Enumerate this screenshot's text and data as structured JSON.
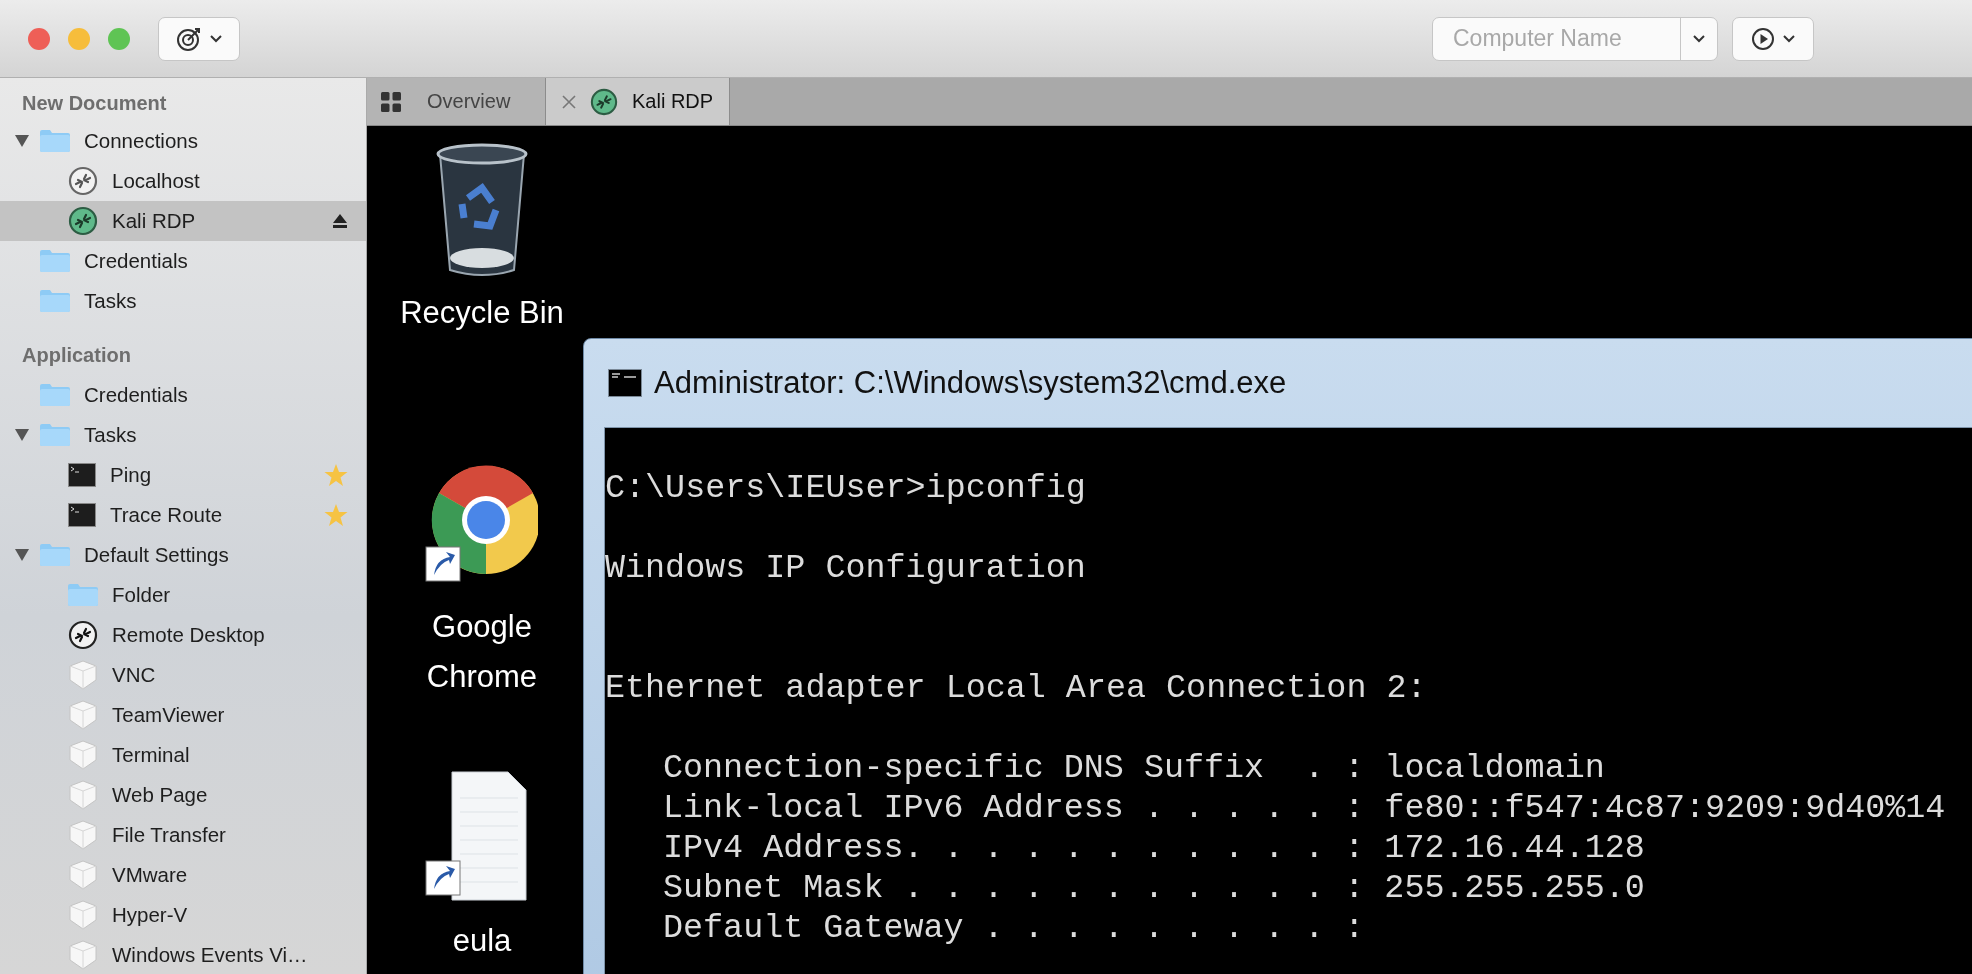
{
  "toolbar": {
    "computer_name": {
      "placeholder": "Computer Name"
    }
  },
  "tabs": [
    {
      "label": "Overview",
      "kind": "overview",
      "selected": false
    },
    {
      "label": "Kali RDP",
      "kind": "rdp",
      "selected": true
    }
  ],
  "sidebar": {
    "sections": [
      {
        "title": "New Document",
        "items": [
          {
            "label": "Connections",
            "kind": "folder",
            "selected": false,
            "expanded": true,
            "children": [
              {
                "label": "Localhost",
                "kind": "rdp",
                "selected": false,
                "connected": false
              },
              {
                "label": "Kali RDP",
                "kind": "rdp",
                "selected": true,
                "connected": true
              }
            ]
          },
          {
            "label": "Credentials",
            "kind": "folder",
            "selected": false
          },
          {
            "label": "Tasks",
            "kind": "folder",
            "selected": false
          }
        ]
      },
      {
        "title": "Application",
        "items": [
          {
            "label": "Credentials",
            "kind": "folder",
            "selected": false
          },
          {
            "label": "Tasks",
            "kind": "folder",
            "selected": false,
            "expanded": true,
            "children": [
              {
                "label": "Ping",
                "kind": "terminal",
                "selected": false,
                "starred": true
              },
              {
                "label": "Trace Route",
                "kind": "terminal",
                "selected": false,
                "starred": true
              }
            ]
          },
          {
            "label": "Default Settings",
            "kind": "folder",
            "selected": false,
            "expanded": true,
            "children": [
              {
                "label": "Folder",
                "kind": "folder",
                "selected": false
              },
              {
                "label": "Remote Desktop",
                "kind": "rdp_template",
                "selected": false
              },
              {
                "label": "VNC",
                "kind": "plugin",
                "selected": false
              },
              {
                "label": "TeamViewer",
                "kind": "plugin",
                "selected": false
              },
              {
                "label": "Terminal",
                "kind": "plugin",
                "selected": false
              },
              {
                "label": "Web Page",
                "kind": "plugin",
                "selected": false
              },
              {
                "label": "File Transfer",
                "kind": "plugin",
                "selected": false
              },
              {
                "label": "VMware",
                "kind": "plugin",
                "selected": false
              },
              {
                "label": "Hyper-V",
                "kind": "plugin",
                "selected": false
              },
              {
                "label": "Windows Events Vi…",
                "kind": "plugin",
                "selected": false
              }
            ]
          }
        ]
      }
    ]
  },
  "desktop": {
    "icons": [
      {
        "label": "Recycle Bin",
        "kind": "recycle_bin",
        "shortcut": false
      },
      {
        "label": "Google Chrome",
        "kind": "browser",
        "shortcut": true
      },
      {
        "label": "eula",
        "kind": "document",
        "shortcut": true
      }
    ],
    "cmd_window": {
      "title": "Administrator: C:\\Windows\\system32\\cmd.exe",
      "lines": [
        {
          "kind": "prompt",
          "text": "C:\\Users\\IEUser>ipconfig"
        },
        {
          "kind": "header",
          "text": "Windows IP Configuration"
        },
        {
          "kind": "adapter",
          "text": "Ethernet adapter Local Area Connection 2:"
        },
        {
          "kind": "detail",
          "text": "Connection-specific DNS Suffix  . : localdomain"
        },
        {
          "kind": "detail",
          "text": "Link-local IPv6 Address . . . . . : fe80::f547:4c87:9209:9d40%14"
        },
        {
          "kind": "detail",
          "text": "IPv4 Address. . . . . . . . . . . : 172.16.44.128"
        },
        {
          "kind": "detail",
          "text": "Subnet Mask . . . . . . . . . . . : 255.255.255.0"
        },
        {
          "kind": "detail",
          "text": "Default Gateway . . . . . . . . . :"
        }
      ]
    }
  }
}
